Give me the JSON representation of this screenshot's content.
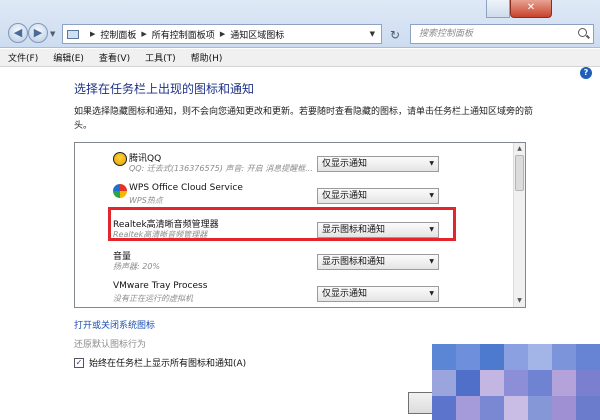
{
  "address": {
    "crumbs": [
      "控制面板",
      "所有控制面板项",
      "通知区域图标"
    ],
    "search_placeholder": "搜索控制面板"
  },
  "menu": [
    "文件(F)",
    "编辑(E)",
    "查看(V)",
    "工具(T)",
    "帮助(H)"
  ],
  "heading": "选择在任务栏上出现的图标和通知",
  "description": "如果选择隐藏图标和通知，则不会向您通知更改和更新。若要随时查看隐藏的图标，请单击任务栏上通知区域旁的箭头。",
  "rows": [
    {
      "name": "腾讯QQ",
      "sub": "QQ: 迁去式(136376575) 声音: 开启 消息提醒框...",
      "setting": "仅显示通知",
      "icon": "qq-penguin-icon"
    },
    {
      "name": "WPS Office Cloud Service",
      "sub": "WPS热点",
      "setting": "仅显示通知",
      "icon": "wps-cloud-icon"
    },
    {
      "name": "Realtek高清晰音频管理器",
      "sub": "Realtek高清晰音频管理器",
      "setting": "显示图标和通知",
      "icon": ""
    },
    {
      "name": "音量",
      "sub": "扬声器: 20%",
      "setting": "显示图标和通知",
      "icon": ""
    },
    {
      "name": "VMware Tray Process",
      "sub": "没有正在运行的虚拟机",
      "setting": "仅显示通知",
      "icon": ""
    }
  ],
  "links": {
    "system_icons": "打开或关闭系统图标",
    "restore": "还原默认图标行为"
  },
  "checkbox": {
    "label": "始终在任务栏上显示所有图标和通知(A)",
    "checked": true
  },
  "colors": {
    "heading": "#1e3287",
    "link": "#1a4fb0",
    "highlight": "#e3262c",
    "mosaic": [
      "#5b86d6",
      "#6e8fdc",
      "#4d79cf",
      "#8aa0e0",
      "#a3b5e6",
      "#7c95da",
      "#6783d4",
      "#9aa4dd",
      "#4f6fc9",
      "#c3b6e2",
      "#8d8ed8",
      "#6f83d2",
      "#b4a3db",
      "#7b7fd0",
      "#5d74cc",
      "#a59bda",
      "#7a88d4",
      "#c9bde6",
      "#8697d8",
      "#9f8fd3",
      "#6b7ccc"
    ]
  }
}
